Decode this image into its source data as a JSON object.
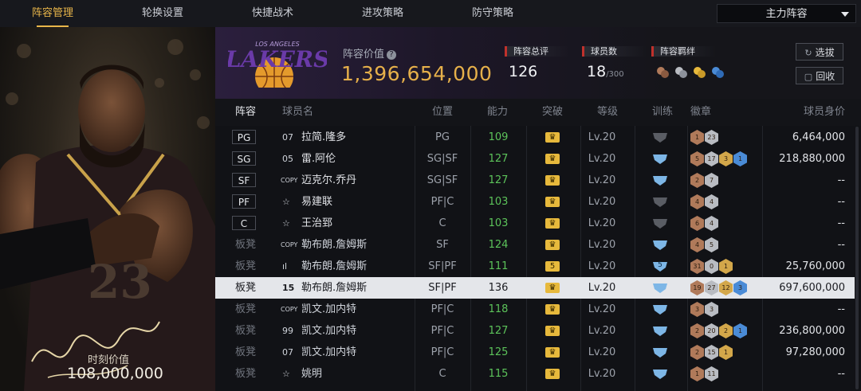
{
  "tabs": [
    {
      "label": "阵容管理",
      "active": true
    },
    {
      "label": "轮换设置",
      "active": false
    },
    {
      "label": "快捷战术",
      "active": false
    },
    {
      "label": "进攻策略",
      "active": false
    },
    {
      "label": "防守策略",
      "active": false
    }
  ],
  "lineup_select": {
    "value": "主力阵容"
  },
  "player_panel": {
    "jersey_number": "23",
    "market_label": "时刻价值",
    "market_value": "108,000,000"
  },
  "team": {
    "logo_text": "LAKERS",
    "logo_subtext": "LOS ANGELES",
    "value_label": "阵容价值",
    "value": "1,396,654,000",
    "rating_label": "阵容总评",
    "rating": "126",
    "players_label": "球员数",
    "players_count": "18",
    "players_max": "/300",
    "bonds_label": "阵容羁绊"
  },
  "buttons": {
    "select": "选拔",
    "recycle": "回收"
  },
  "table": {
    "headers": {
      "lineup": "阵容",
      "name": "球员名",
      "pos": "位置",
      "ability": "能力",
      "breakthrough": "突破",
      "level": "等级",
      "training": "训练",
      "badges": "徽章",
      "value": "球员身价"
    },
    "rows": [
      {
        "slot": "PG",
        "starter": true,
        "num": "07",
        "name": "拉简.隆多",
        "pos": "PG",
        "ability": "109",
        "level": "Lv.20",
        "badges": [
          "1",
          "23"
        ],
        "value": "6,464,000"
      },
      {
        "slot": "SG",
        "starter": true,
        "num": "05",
        "name": "雷.阿伦",
        "pos": "SG|SF",
        "ability": "127",
        "level": "Lv.20",
        "badges": [
          "5",
          "17",
          "3",
          "1"
        ],
        "value": "218,880,000"
      },
      {
        "slot": "SF",
        "starter": true,
        "num": "COPY",
        "name": "迈克尔.乔丹",
        "pos": "SG|SF",
        "ability": "127",
        "level": "Lv.20",
        "badges": [
          "2",
          "7"
        ],
        "value": "--"
      },
      {
        "slot": "PF",
        "starter": true,
        "num": "☆",
        "name": "易建联",
        "pos": "PF|C",
        "ability": "103",
        "level": "Lv.20",
        "badges": [
          "4",
          "4"
        ],
        "value": "--"
      },
      {
        "slot": "C",
        "starter": true,
        "num": "☆",
        "name": "王治郅",
        "pos": "C",
        "ability": "103",
        "level": "Lv.20",
        "badges": [
          "6",
          "4"
        ],
        "value": "--"
      },
      {
        "slot": "板凳",
        "starter": false,
        "num": "COPY",
        "name": "勒布朗.詹姆斯",
        "pos": "SF",
        "ability": "124",
        "level": "Lv.20",
        "badges": [
          "4",
          "5"
        ],
        "value": "--"
      },
      {
        "slot": "板凳",
        "starter": false,
        "num": "ıl",
        "name": "勒布朗.詹姆斯",
        "pos": "SF|PF",
        "ability": "111",
        "level": "Lv.20",
        "crown": "5",
        "train": "5",
        "badges": [
          "31",
          "0",
          "1"
        ],
        "value": "25,760,000"
      },
      {
        "slot": "板凳",
        "starter": false,
        "selected": true,
        "num": "15",
        "name": "勒布朗.詹姆斯",
        "pos": "SF|PF",
        "ability": "136",
        "level": "Lv.20",
        "badges": [
          "19",
          "27",
          "12",
          "3"
        ],
        "value": "697,600,000"
      },
      {
        "slot": "板凳",
        "starter": false,
        "num": "COPY",
        "name": "凯文.加内特",
        "pos": "PF|C",
        "ability": "118",
        "level": "Lv.20",
        "badges": [
          "3",
          "3"
        ],
        "value": "--"
      },
      {
        "slot": "板凳",
        "starter": false,
        "num": "99",
        "name": "凯文.加内特",
        "pos": "PF|C",
        "ability": "127",
        "level": "Lv.20",
        "badges": [
          "2",
          "20",
          "2",
          "1"
        ],
        "value": "236,800,000"
      },
      {
        "slot": "板凳",
        "starter": false,
        "num": "07",
        "name": "凯文.加内特",
        "pos": "PF|C",
        "ability": "125",
        "level": "Lv.20",
        "badges": [
          "2",
          "15",
          "1"
        ],
        "value": "97,280,000"
      },
      {
        "slot": "板凳",
        "starter": false,
        "num": "☆",
        "name": "姚明",
        "pos": "C",
        "ability": "115",
        "level": "Lv.20",
        "badges": [
          "1",
          "11"
        ],
        "value": "--"
      }
    ]
  },
  "colors": {
    "accent": "#e8b54a",
    "ability": "#5cc35a",
    "crown": "#e7b93c",
    "badge_bronze": "#b07a5a",
    "badge_silver": "#b9bcc2",
    "badge_gold": "#d3a74a",
    "badge_blue": "#4a8bd6"
  }
}
